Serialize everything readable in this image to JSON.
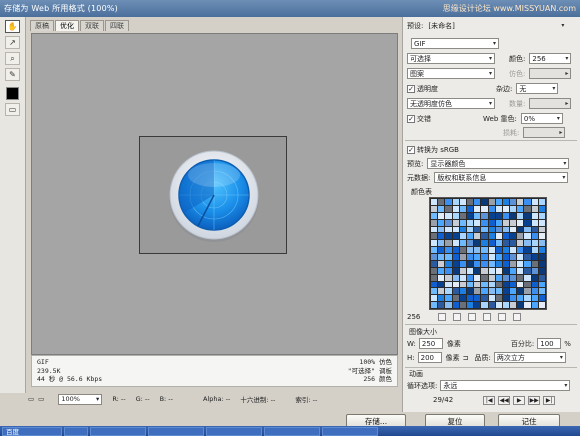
{
  "window": {
    "title": "存储为 Web 所用格式 (100%)",
    "watermark": "思缘设计论坛 www.MISSYUAN.com"
  },
  "tabs": [
    "原稿",
    "优化",
    "双联",
    "四联"
  ],
  "active_tab": "优化",
  "tools": [
    "hand-icon",
    "slice-select-icon",
    "zoom-icon",
    "eyedropper-icon"
  ],
  "info": {
    "format": "GIF",
    "size": "239.5K",
    "time": "44 秒 @ 56.6 Kbps",
    "dither_pct": "100% 仿色",
    "palette": "\"可选择\" 调板",
    "colors": "256 颜色"
  },
  "status": {
    "zoom": "100%",
    "r": "R: --",
    "g": "G: --",
    "b": "B: --",
    "alpha": "Alpha: --",
    "hex": "十六进制: --",
    "index": "索引: --"
  },
  "panel": {
    "preset_label": "预设:",
    "preset_value": "[未命名]",
    "format": "GIF",
    "reduction": "可选择",
    "colors_label": "颜色:",
    "colors_value": "256",
    "dither_algo": "图案",
    "dither_label": "仿色:",
    "transparency_label": "透明度",
    "matte_label": "杂边:",
    "matte_value": "无",
    "trans_dither": "无透明度仿色",
    "amount_label": "数量:",
    "interlaced_label": "交错",
    "web_snap_label": "Web 靠色:",
    "web_snap_value": "0%",
    "lossy_label": "损耗:",
    "srgb_label": "转换为 sRGB",
    "preview_label": "预览:",
    "preview_value": "显示器颜色",
    "metadata_label": "元数据:",
    "metadata_value": "版权和联系信息",
    "color_table_label": "颜色表",
    "color_count": "256",
    "image_size_label": "图像大小",
    "w_label": "W:",
    "w_value": "250",
    "h_label": "H:",
    "h_value": "200",
    "unit": "像素",
    "percent_label": "百分比:",
    "percent_value": "100",
    "pct_sign": "%",
    "quality_label": "品质:",
    "quality_value": "两次立方",
    "animation_label": "动画",
    "loop_label": "循环选项:",
    "loop_value": "永远",
    "frame": "29/42"
  },
  "buttons": {
    "save": "存储...",
    "reset": "复位",
    "remember": "记住"
  },
  "taskbar": {
    "items": [
      "百度",
      "",
      "",
      "",
      "",
      "",
      ""
    ]
  },
  "colors": {
    "accent_blue": "#1d8fe6",
    "canvas_bg": "#a5a5a5"
  }
}
